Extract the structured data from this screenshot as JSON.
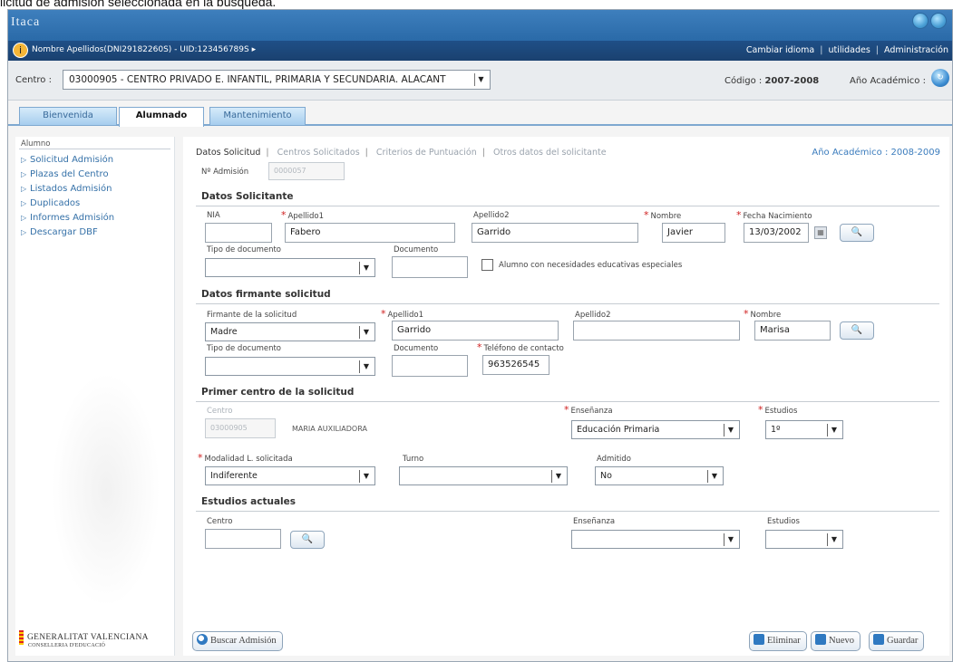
{
  "caption": "licitud de admisión seleccionada en la búsqueda.",
  "header": {
    "logo": "Itaca",
    "user_info": "Nombre Apellidos(DNI29182260S) - UID:123456789S ▸",
    "links": [
      "Cambiar idioma",
      "utilidades",
      "Administración"
    ]
  },
  "centro": {
    "label": "Centro :",
    "value": "03000905 - CENTRO PRIVADO E. INFANTIL, PRIMARIA Y SECUNDARIA. ALACANT",
    "codigo_label": "Código :",
    "codigo_value": "2007-2008",
    "anio_label": "Año Académico :"
  },
  "tabs": [
    "Bienvenida",
    "Alumnado",
    "Mantenimiento"
  ],
  "sidebar": {
    "heading": "Alumno",
    "items": [
      "Solicitud Admisión",
      "Plazas del Centro",
      "Listados Admisión",
      "Duplicados",
      "Informes Admisión",
      "Descargar DBF"
    ]
  },
  "footer_logo": {
    "text": "GENERALITAT VALENCIANA",
    "sub": "CONSELLERIA D'EDUCACIÓ"
  },
  "steps": [
    "Datos Solicitud",
    "Centros Solicitados",
    "Criterios de Puntuación",
    "Otros datos del solicitante"
  ],
  "academic_year": "Año Académico : 2008-2009",
  "admision": {
    "label": "Nº Admisión",
    "value": "0000057"
  },
  "solicitante": {
    "title": "Datos Solicitante",
    "nia_label": "NIA",
    "nia": "",
    "apellido1_label": "Apellido1",
    "apellido1": "Fabero",
    "apellido2_label": "Apellido2",
    "apellido2": "Garrido",
    "nombre_label": "Nombre",
    "nombre": "Javier",
    "fecha_label": "Fecha Nacimiento",
    "fecha": "13/03/2002",
    "tipo_doc_label": "Tipo de documento",
    "documento_label": "Documento",
    "necesidades_label": "Alumno con necesidades educativas especiales"
  },
  "firmante": {
    "title": "Datos firmante solicitud",
    "firmante_label": "Firmante de la solicitud",
    "firmante": "Madre",
    "apellido1_label": "Apellido1",
    "apellido1": "Garrido",
    "apellido2_label": "Apellido2",
    "apellido2": "",
    "nombre_label": "Nombre",
    "nombre": "Marisa",
    "tipo_doc_label": "Tipo de documento",
    "documento_label": "Documento",
    "telefono_label": "Teléfono de contacto",
    "telefono": "963526545"
  },
  "primer_centro": {
    "title": "Primer centro de la solicitud",
    "centro_label": "Centro",
    "centro": "03000905",
    "centro_name": "MARIA AUXILIADORA",
    "ensenanza_label": "Enseñanza",
    "ensenanza": "Educación Primaria",
    "estudios_label": "Estudios",
    "estudios": "1º",
    "modalidad_label": "Modalidad L. solicitada",
    "modalidad": "Indiferente",
    "turno_label": "Turno",
    "turno": "",
    "admitido_label": "Admitido",
    "admitido": "No"
  },
  "estudios_actuales": {
    "title": "Estudios actuales",
    "centro_label": "Centro",
    "ensenanza_label": "Enseñanza",
    "estudios_label": "Estudios"
  },
  "buttons": {
    "buscar": "Buscar Admisión",
    "eliminar": "Eliminar",
    "nuevo": "Nuevo",
    "guardar": "Guardar"
  }
}
